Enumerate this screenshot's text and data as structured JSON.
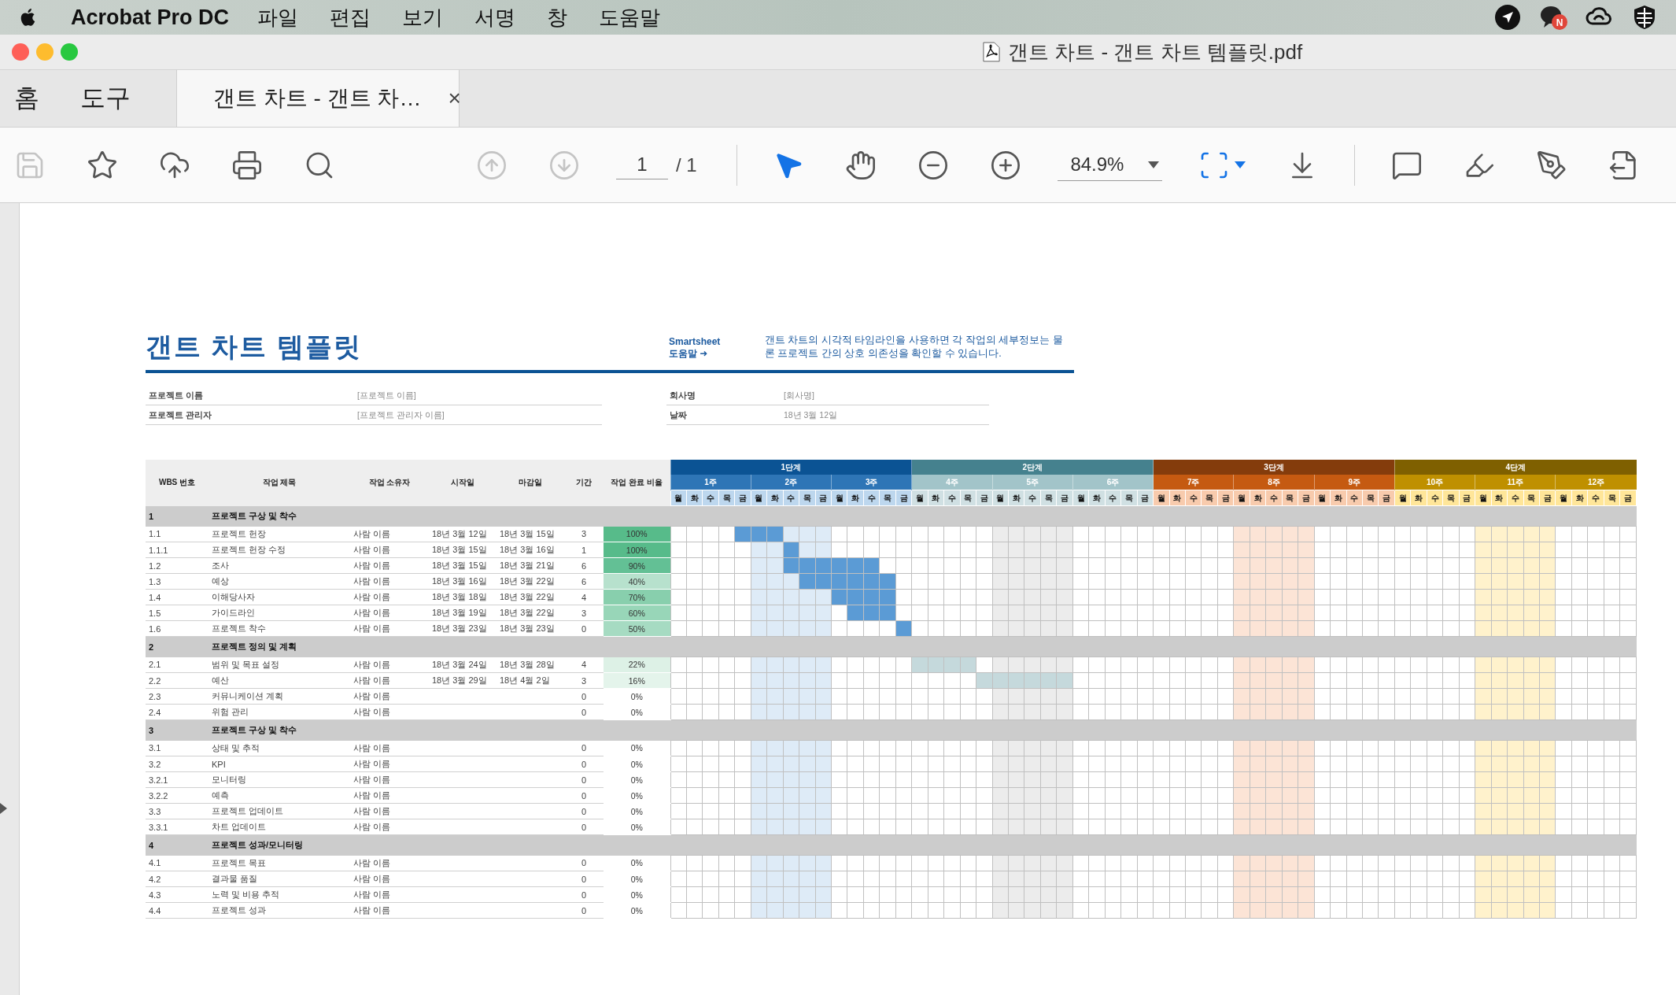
{
  "menubar": {
    "app": "Acrobat Pro DC",
    "menus": [
      "파일",
      "편집",
      "보기",
      "서명",
      "창",
      "도움말"
    ],
    "badge": "N"
  },
  "window": {
    "title": "갠트 차트 - 갠트 차트 템플릿.pdf"
  },
  "tabs": [
    {
      "label": "홈",
      "selected": false
    },
    {
      "label": "도구",
      "selected": false
    },
    {
      "label": "갠트 차트 - 갠트 차…",
      "selected": true,
      "close": "×"
    }
  ],
  "toolbar": {
    "file_tools": [
      {
        "kind": "save",
        "disabled": true
      },
      {
        "kind": "star",
        "disabled": false
      },
      {
        "kind": "upload",
        "disabled": false
      },
      {
        "kind": "print",
        "disabled": false
      },
      {
        "kind": "find",
        "disabled": false
      }
    ],
    "page_nav": [
      {
        "kind": "prev",
        "disabled": true
      },
      {
        "kind": "next",
        "disabled": true
      }
    ],
    "page": "1",
    "page_total": "/ 1",
    "view_tools": [
      {
        "kind": "select",
        "selected": true
      },
      {
        "kind": "hand",
        "selected": false
      },
      {
        "kind": "zoom-out",
        "selected": false
      },
      {
        "kind": "zoom-in",
        "selected": false
      }
    ],
    "zoom": "84.9%",
    "page_tools": [
      {
        "kind": "fit"
      },
      {
        "kind": "scroll"
      }
    ],
    "annotate_tools": [
      {
        "kind": "comment"
      },
      {
        "kind": "highlight"
      },
      {
        "kind": "sign"
      },
      {
        "kind": "more"
      }
    ]
  },
  "document": {
    "title": "갠트 차트 템플릿",
    "brand": "Smartsheet",
    "help_link": "도움말 ➜",
    "description": "갠트 차트의 시각적 타임라인을 사용하면 각 작업의 세부정보는 물론 프로젝트 간의 상호 의존성을 확인할 수 있습니다.",
    "fields_left": [
      {
        "label": "프로젝트 이름",
        "value": "[프로젝트 이름]"
      },
      {
        "label": "프로젝트 관리자",
        "value": "[프로젝트 관리자 이름]"
      }
    ],
    "fields_right": [
      {
        "label": "회사명",
        "value": "[회사명]"
      },
      {
        "label": "날짜",
        "value": "18년 3월 12일"
      }
    ],
    "columns": [
      "WBS 번호",
      "작업 제목",
      "작업 소유자",
      "시작일",
      "마감일",
      "기간",
      "작업 완료 비율"
    ],
    "phases": [
      {
        "label": "1단계",
        "color": "#0b5394",
        "day_header": {
          "color": "#bdd7ee"
        },
        "weeks": [
          {
            "label": "1주",
            "color": "#2e75b6",
            "days": [
              "월",
              "화",
              "수",
              "목",
              "금"
            ]
          },
          {
            "label": "2주",
            "color": "#2e75b6",
            "shade": {
              "color": "#deebf7"
            },
            "days": [
              "월",
              "화",
              "수",
              "목",
              "금"
            ]
          },
          {
            "label": "3주",
            "color": "#2e75b6",
            "days": [
              "월",
              "화",
              "수",
              "목",
              "금"
            ]
          }
        ]
      },
      {
        "label": "2단계",
        "color": "#45818e",
        "day_header": {
          "color": "#d0e0e3"
        },
        "weeks": [
          {
            "label": "4주",
            "color": "#a2c4c9",
            "days": [
              "월",
              "화",
              "수",
              "목",
              "금"
            ]
          },
          {
            "label": "5주",
            "color": "#a2c4c9",
            "shade": {
              "color": "#ececec"
            },
            "days": [
              "월",
              "화",
              "수",
              "목",
              "금"
            ]
          },
          {
            "label": "6주",
            "color": "#a2c4c9",
            "days": [
              "월",
              "화",
              "수",
              "목",
              "금"
            ]
          }
        ]
      },
      {
        "label": "3단계",
        "color": "#843c0c",
        "day_header": {
          "color": "#f8cbad"
        },
        "weeks": [
          {
            "label": "7주",
            "color": "#c55a11",
            "days": [
              "월",
              "화",
              "수",
              "목",
              "금"
            ]
          },
          {
            "label": "8주",
            "color": "#c55a11",
            "shade": {
              "color": "#fce4d6"
            },
            "days": [
              "월",
              "화",
              "수",
              "목",
              "금"
            ]
          },
          {
            "label": "9주",
            "color": "#c55a11",
            "days": [
              "월",
              "화",
              "수",
              "목",
              "금"
            ]
          }
        ]
      },
      {
        "label": "4단계",
        "color": "#7f6000",
        "day_header": {
          "color": "#ffe699"
        },
        "weeks": [
          {
            "label": "10주",
            "color": "#bf9000",
            "days": [
              "월",
              "화",
              "수",
              "목",
              "금"
            ]
          },
          {
            "label": "11주",
            "color": "#bf9000",
            "shade": {
              "color": "#fff2cc"
            },
            "days": [
              "월",
              "화",
              "수",
              "목",
              "금"
            ]
          },
          {
            "label": "12주",
            "color": "#bf9000",
            "days": [
              "월",
              "화",
              "수",
              "목",
              "금"
            ]
          }
        ]
      }
    ],
    "groups": [
      {
        "number": "1",
        "title": "프로젝트 구상 및 착수",
        "tasks": [
          {
            "wbs": "1.1",
            "title": "프로젝트 헌장",
            "owner": "사람 이름",
            "start": "18년 3월 12일",
            "end": "18년 3월 15일",
            "duration": "3",
            "percent": {
              "label": "100%",
              "color": "#57bb8a"
            },
            "bar": {
              "color": "#5b9bd5",
              "days": [
                false,
                false,
                false,
                false,
                true,
                true,
                true
              ]
            }
          },
          {
            "wbs": "1.1.1",
            "title": "프로젝트 헌장 수정",
            "owner": "사람 이름",
            "start": "18년 3월 15일",
            "end": "18년 3월 16일",
            "duration": "1",
            "percent": {
              "label": "100%",
              "color": "#57bb8a"
            },
            "bar": {
              "color": "#5b9bd5",
              "days": [
                false,
                false,
                false,
                false,
                false,
                false,
                false,
                true
              ]
            }
          },
          {
            "wbs": "1.2",
            "title": "조사",
            "owner": "사람 이름",
            "start": "18년 3월 15일",
            "end": "18년 3월 21일",
            "duration": "6",
            "percent": {
              "label": "90%",
              "color": "#63c095"
            },
            "bar": {
              "color": "#5b9bd5",
              "days": [
                false,
                false,
                false,
                false,
                false,
                false,
                false,
                true,
                true,
                true,
                true,
                true,
                true
              ]
            }
          },
          {
            "wbs": "1.3",
            "title": "예상",
            "owner": "사람 이름",
            "start": "18년 3월 16일",
            "end": "18년 3월 22일",
            "duration": "6",
            "percent": {
              "label": "40%",
              "color": "#b7e1cd"
            },
            "bar": {
              "color": "#5b9bd5",
              "days": [
                false,
                false,
                false,
                false,
                false,
                false,
                false,
                false,
                true,
                true,
                true,
                true,
                true,
                true
              ]
            }
          },
          {
            "wbs": "1.4",
            "title": "이해당사자",
            "owner": "사람 이름",
            "start": "18년 3월 18일",
            "end": "18년 3월 22일",
            "duration": "4",
            "percent": {
              "label": "70%",
              "color": "#88cfad"
            },
            "bar": {
              "color": "#5b9bd5",
              "days": [
                false,
                false,
                false,
                false,
                false,
                false,
                false,
                false,
                false,
                false,
                true,
                true,
                true,
                true
              ]
            }
          },
          {
            "wbs": "1.5",
            "title": "가이드라인",
            "owner": "사람 이름",
            "start": "18년 3월 19일",
            "end": "18년 3월 22일",
            "duration": "3",
            "percent": {
              "label": "60%",
              "color": "#98d6b8"
            },
            "bar": {
              "color": "#5b9bd5",
              "days": [
                false,
                false,
                false,
                false,
                false,
                false,
                false,
                false,
                false,
                false,
                false,
                true,
                true,
                true
              ]
            }
          },
          {
            "wbs": "1.6",
            "title": "프로젝트 착수",
            "owner": "사람 이름",
            "start": "18년 3월 23일",
            "end": "18년 3월 23일",
            "duration": "0",
            "percent": {
              "label": "50%",
              "color": "#a6dbc2"
            },
            "bar": {
              "color": "#5b9bd5",
              "days": [
                false,
                false,
                false,
                false,
                false,
                false,
                false,
                false,
                false,
                false,
                false,
                false,
                false,
                false,
                true
              ]
            }
          }
        ]
      },
      {
        "number": "2",
        "title": "프로젝트 정의 및 계획",
        "tasks": [
          {
            "wbs": "2.1",
            "title": "범위 및 목표 설정",
            "owner": "사람 이름",
            "start": "18년 3월 24일",
            "end": "18년 3월 28일",
            "duration": "4",
            "percent": {
              "label": "22%",
              "color": "#ddf1e6"
            },
            "bar": {
              "color": "#c5d9dc",
              "days": [
                false,
                false,
                false,
                false,
                false,
                false,
                false,
                false,
                false,
                false,
                false,
                false,
                false,
                false,
                false,
                true,
                true,
                true,
                true
              ]
            }
          },
          {
            "wbs": "2.2",
            "title": "예산",
            "owner": "사람 이름",
            "start": "18년 3월 29일",
            "end": "18년 4월 2일",
            "duration": "3",
            "percent": {
              "label": "16%",
              "color": "#e4f4eb"
            },
            "bar": {
              "color": "#c5d9dc",
              "days": [
                false,
                false,
                false,
                false,
                false,
                false,
                false,
                false,
                false,
                false,
                false,
                false,
                false,
                false,
                false,
                false,
                false,
                false,
                false,
                true,
                true,
                true,
                true,
                true,
                true
              ]
            }
          },
          {
            "wbs": "2.3",
            "title": "커뮤니케이션 계획",
            "owner": "사람 이름",
            "duration": "0",
            "percent": {
              "label": "0%"
            }
          },
          {
            "wbs": "2.4",
            "title": "위험 관리",
            "owner": "사람 이름",
            "duration": "0",
            "percent": {
              "label": "0%"
            }
          }
        ]
      },
      {
        "number": "3",
        "title": "프로젝트 구상 및 착수",
        "tasks": [
          {
            "wbs": "3.1",
            "title": "상태 및 추적",
            "owner": "사람 이름",
            "duration": "0",
            "percent": {
              "label": "0%"
            }
          },
          {
            "wbs": "3.2",
            "title": "KPI",
            "owner": "사람 이름",
            "duration": "0",
            "percent": {
              "label": "0%"
            }
          },
          {
            "wbs": "3.2.1",
            "title": "모니터링",
            "owner": "사람 이름",
            "duration": "0",
            "percent": {
              "label": "0%"
            }
          },
          {
            "wbs": "3.2.2",
            "title": "예측",
            "owner": "사람 이름",
            "duration": "0",
            "percent": {
              "label": "0%"
            }
          },
          {
            "wbs": "3.3",
            "title": "프로젝트 업데이트",
            "owner": "사람 이름",
            "duration": "0",
            "percent": {
              "label": "0%"
            }
          },
          {
            "wbs": "3.3.1",
            "title": "차트 업데이트",
            "owner": "사람 이름",
            "duration": "0",
            "percent": {
              "label": "0%"
            }
          }
        ]
      },
      {
        "number": "4",
        "title": "프로젝트 성과/모니터링",
        "tasks": [
          {
            "wbs": "4.1",
            "title": "프로젝트 목표",
            "owner": "사람 이름",
            "duration": "0",
            "percent": {
              "label": "0%"
            }
          },
          {
            "wbs": "4.2",
            "title": "결과물 품질",
            "owner": "사람 이름",
            "duration": "0",
            "percent": {
              "label": "0%"
            }
          },
          {
            "wbs": "4.3",
            "title": "노력 및 비용 추적",
            "owner": "사람 이름",
            "duration": "0",
            "percent": {
              "label": "0%"
            }
          },
          {
            "wbs": "4.4",
            "title": "프로젝트 성과",
            "owner": "사람 이름",
            "duration": "0",
            "percent": {
              "label": "0%"
            }
          }
        ]
      }
    ]
  }
}
